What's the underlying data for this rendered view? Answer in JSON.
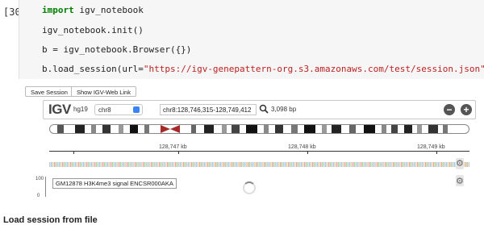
{
  "cell": {
    "prompt": "[30]",
    "lines": {
      "l1_kw": "import",
      "l1_rest": " igv_notebook",
      "l2": "igv_notebook.init()",
      "l3": "b = igv_notebook.Browser({})",
      "l4_pre": "b.load_session(url=",
      "l4_str": "\"https://igv-genepattern-org.s3.amazonaws.com/test/session.json\"",
      "l4_post": ")"
    }
  },
  "toolbar": {
    "save_session": "Save Session",
    "show_webapp": "Show IGV-Web Link"
  },
  "navbar": {
    "logo": "IGV",
    "genome": "hg19",
    "chromosome": "chr8",
    "locus": "chr8:128,746,315-128,749,412",
    "bp": "3,098 bp",
    "zoom_out": "−",
    "zoom_in": "+"
  },
  "ruler": {
    "ticks": [
      "128,747 kb",
      "128,748 kb",
      "128,749 kb"
    ]
  },
  "track": {
    "name": "GM12878 H3K4me3 signal ENCSR000AKA",
    "axis_max": "100",
    "axis_min": "0"
  },
  "footer": {
    "heading": "Load session from file"
  },
  "colors": {
    "string": "#ba2121",
    "keyword": "#008000",
    "centromere": "#a52a2a"
  },
  "icons": {
    "search": "search-icon",
    "gear": "gear-icon",
    "zoom_out": "minus-circle-icon",
    "zoom_in": "plus-circle-icon"
  }
}
